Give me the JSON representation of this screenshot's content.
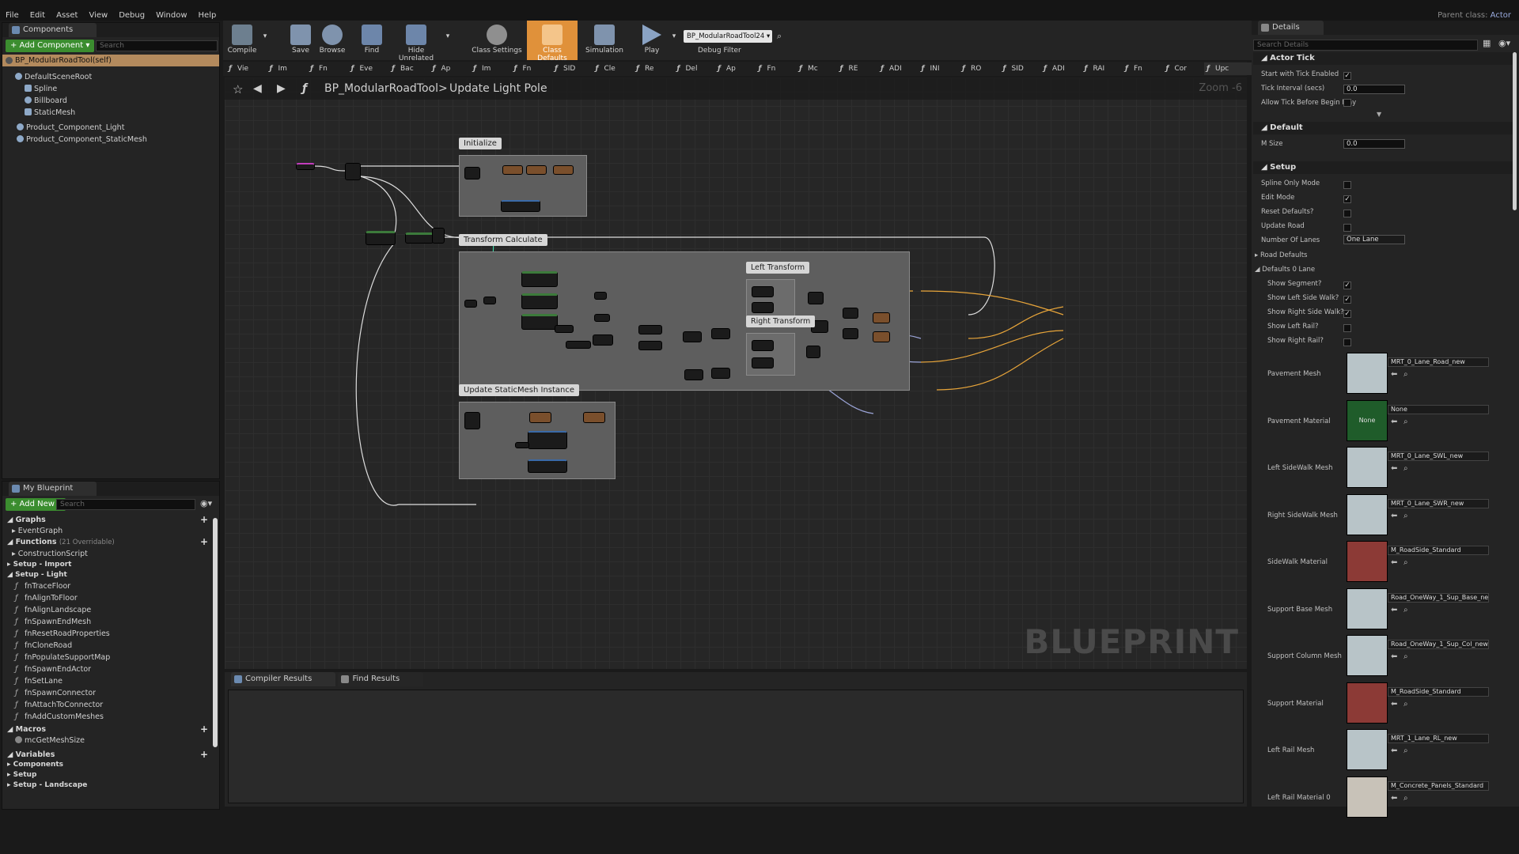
{
  "menu": [
    "File",
    "Edit",
    "Asset",
    "View",
    "Debug",
    "Window",
    "Help"
  ],
  "parent_class": {
    "label": "Parent class:",
    "value": "Actor"
  },
  "components": {
    "tab": "Components",
    "add_button": "+ Add Component ▾",
    "search_placeholder": "Search",
    "self_item": "BP_ModularRoadTool(self)",
    "items": [
      "DefaultSceneRoot",
      "Spline",
      "Billboard",
      "StaticMesh",
      "Product_Component_Light",
      "Product_Component_StaticMesh"
    ]
  },
  "my_blueprint": {
    "tab": "My Blueprint",
    "add_button": "+ Add New ▾",
    "search_placeholder": "Search",
    "graphs_label": "Graphs",
    "event_graph": "EventGraph",
    "functions_label": "Functions",
    "functions_count": "(21 Overridable)",
    "construction_script": "ConstructionScript",
    "setup_import": "Setup - Import",
    "setup_light": "Setup - Light",
    "functions": [
      "fnTraceFloor",
      "fnAlignToFloor",
      "fnAlignLandscape",
      "fnSpawnEndMesh",
      "fnResetRoadProperties",
      "fnCloneRoad",
      "fnPopulateSupportMap",
      "fnSpawnEndActor",
      "fnSetLane",
      "fnSpawnConnector",
      "fnAttachToConnector",
      "fnAddCustomMeshes"
    ],
    "macros_label": "Macros",
    "macro": "mcGetMeshSize",
    "variables_label": "Variables",
    "var_cats": [
      "Components",
      "Setup",
      "Setup - Landscape"
    ]
  },
  "toolbar": {
    "compile": "Compile",
    "save": "Save",
    "browse": "Browse",
    "find": "Find",
    "hide_unrelated": "Hide Unrelated",
    "class_settings": "Class Settings",
    "class_defaults": "Class Defaults",
    "simulation": "Simulation",
    "play": "Play",
    "debug_object": "BP_ModularRoadTool24 ▾",
    "debug_filter": "Debug Filter"
  },
  "function_tabs": [
    "Vie",
    "Im",
    "Fn",
    "Eve",
    "Bac",
    "Ap",
    "Im",
    "Fn",
    "SID",
    "Cle",
    "Re",
    "Del",
    "Ap",
    "Fn",
    "Mc",
    "RE",
    "ADI",
    "INI",
    "RO",
    "SID",
    "ADI",
    "RAI",
    "Fn",
    "Cor",
    "Upc"
  ],
  "graph": {
    "breadcrumb_blueprint": "BP_ModularRoadTool",
    "breadcrumb_sep": ">",
    "breadcrumb_function": "Update Light Pole",
    "zoom": "Zoom -6",
    "comments": [
      "Initialize",
      "Transform Calculate",
      "Left Transform",
      "Right Transform",
      "Update StaticMesh Instance"
    ],
    "watermark": "BLUEPRINT"
  },
  "bottom_tabs": [
    "Compiler Results",
    "Find Results"
  ],
  "details": {
    "tab": "Details",
    "search_placeholder": "Search Details",
    "actor_tick": {
      "label": "Actor Tick",
      "start_with_tick": {
        "label": "Start with Tick Enabled",
        "checked": true
      },
      "tick_interval": {
        "label": "Tick Interval (secs)",
        "value": "0.0"
      },
      "allow_tick": {
        "label": "Allow Tick Before Begin Play",
        "checked": false
      }
    },
    "default": {
      "label": "Default",
      "m_size": {
        "label": "M Size",
        "value": "0.0"
      }
    },
    "setup": {
      "label": "Setup",
      "spline_only": {
        "label": "Spline Only Mode",
        "checked": false
      },
      "edit_mode": {
        "label": "Edit Mode",
        "checked": true
      },
      "reset_defaults": {
        "label": "Reset Defaults?",
        "checked": false
      },
      "update_road": {
        "label": "Update Road",
        "checked": false
      },
      "lanes": {
        "label": "Number Of Lanes",
        "value": "One Lane"
      },
      "road_defaults": "Road Defaults",
      "defaults_0_lane": "Defaults 0 Lane",
      "show_segment": {
        "label": "Show Segment?",
        "checked": true
      },
      "show_left_walk": {
        "label": "Show Left Side Walk?",
        "checked": true
      },
      "show_right_walk": {
        "label": "Show Right Side Walk?",
        "checked": true
      },
      "show_left_rail": {
        "label": "Show Left Rail?",
        "checked": false
      },
      "show_right_rail": {
        "label": "Show Right Rail?",
        "checked": false
      }
    },
    "assets": [
      {
        "label": "Pavement Mesh",
        "value": "MRT_0_Lane_Road_new",
        "thumb": "#b8c4c8"
      },
      {
        "label": "Pavement Material",
        "value": "None",
        "thumb": "#1f5c2a"
      },
      {
        "label": "Left SideWalk Mesh",
        "value": "MRT_0_Lane_SWL_new",
        "thumb": "#b8c4c8"
      },
      {
        "label": "Right SideWalk Mesh",
        "value": "MRT_0_Lane_SWR_new",
        "thumb": "#b8c4c8"
      },
      {
        "label": "SideWalk Material",
        "value": "M_RoadSide_Standard",
        "thumb": "#8c3a36"
      },
      {
        "label": "Support Base Mesh",
        "value": "Road_OneWay_1_Sup_Base_new",
        "thumb": "#b8c4c8"
      },
      {
        "label": "Support Column Mesh",
        "value": "Road_OneWay_1_Sup_Col_new",
        "thumb": "#b8c4c8"
      },
      {
        "label": "Support Material",
        "value": "M_RoadSide_Standard",
        "thumb": "#8c3a36"
      },
      {
        "label": "Left Rail Mesh",
        "value": "MRT_1_Lane_RL_new",
        "thumb": "#b8c4c8"
      },
      {
        "label": "Left Rail Material 0",
        "value": "M_Concrete_Panels_Standard",
        "thumb": "#c8c2b8"
      }
    ]
  }
}
